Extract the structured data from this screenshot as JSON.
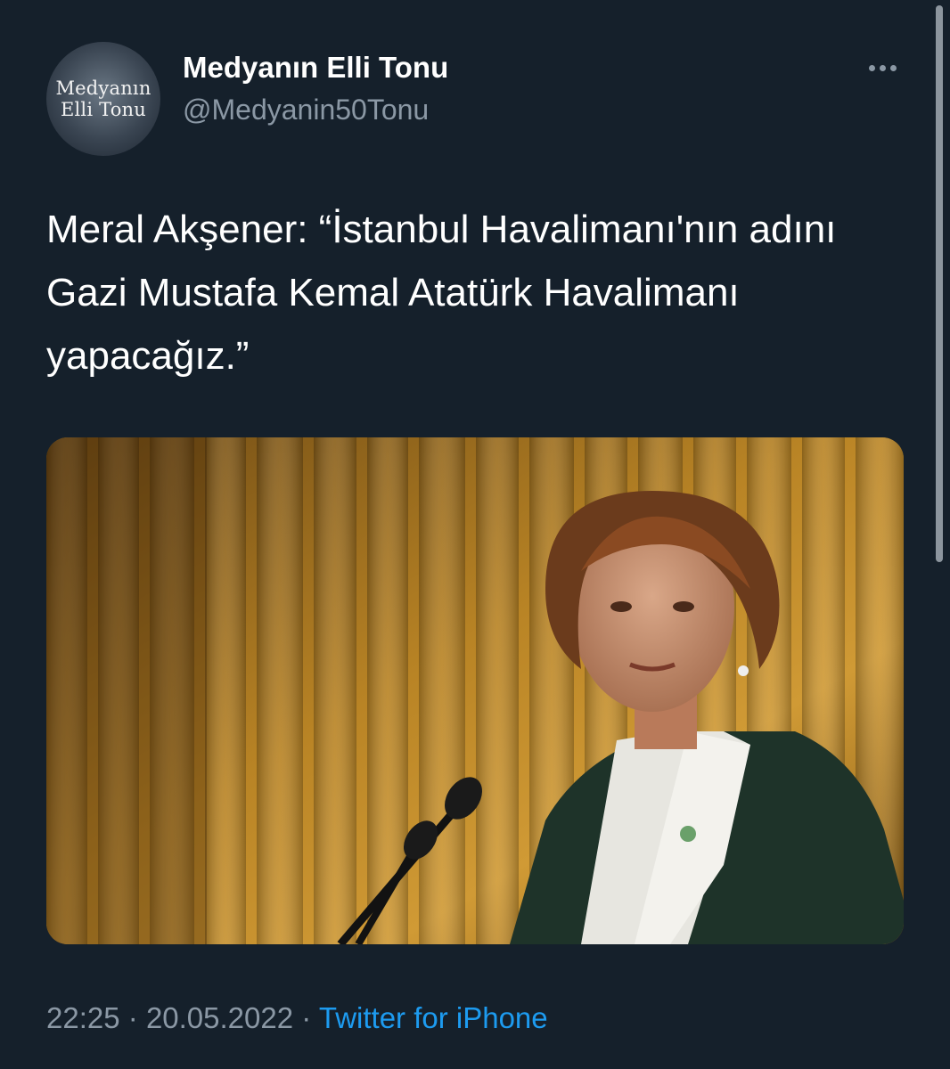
{
  "account": {
    "display_name": "Medyanın Elli Tonu",
    "handle": "@Medyanin50Tonu",
    "avatar_text_line1": "Medyanın",
    "avatar_text_line2": "Elli Tonu"
  },
  "tweet": {
    "text": "Meral Akşener: “İstanbul Havalimanı'nın adını Gazi Mustafa Kemal Atatürk Havalimanı yapacağız.”",
    "time": "22:25",
    "separator": "·",
    "date": "20.05.2022",
    "source": "Twitter for iPhone"
  },
  "media": {
    "photo": "photo of a speaker at a podium microphone in front of a gold curtain"
  },
  "icons": {
    "more": "more-options-icon"
  },
  "colors": {
    "background": "#15202b",
    "text_primary": "#ffffff",
    "text_secondary": "#8b98a5",
    "link": "#1d9bf0"
  }
}
